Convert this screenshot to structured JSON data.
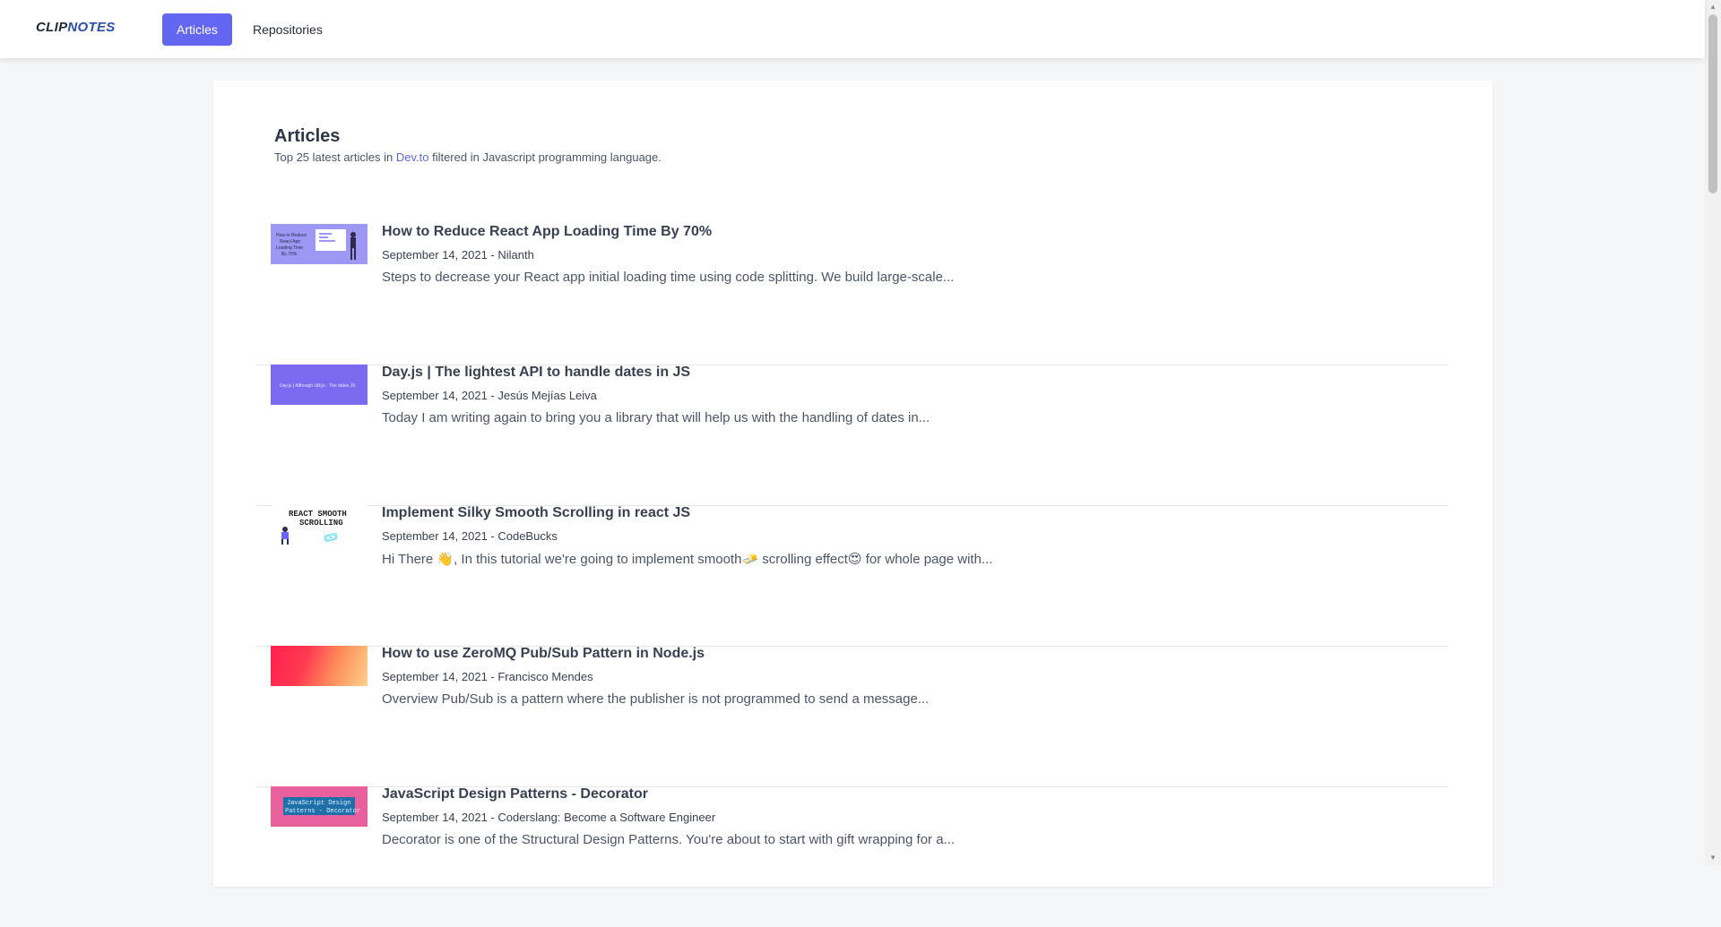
{
  "brand": {
    "part1": "CLIP",
    "part2": "NOTES"
  },
  "nav": {
    "articles": "Articles",
    "repositories": "Repositories"
  },
  "page": {
    "title": "Articles",
    "subtitle_pre": "Top 25 latest articles in ",
    "subtitle_link": "Dev.to",
    "subtitle_post": " filtered in Javascript programming language."
  },
  "articles": [
    {
      "title": "How to Reduce React App Loading Time By 70%",
      "meta": "September 14, 2021 - Nilanth",
      "desc": "Steps to decrease your React app initial loading time using code splitting. We build large-scale...",
      "thumb_text": "How to Reduce React App Loading Time By 70%"
    },
    {
      "title": "Day.js | The lightest API to handle dates in JS",
      "meta": "September 14, 2021 - Jesús Mejías Leiva",
      "desc": "Today I am writing again to bring you a library that will help us with the handling of dates in...",
      "thumb_text": "Day.js | Although Util.js"
    },
    {
      "title": "Implement Silky Smooth Scrolling in react JS",
      "meta": "September 14, 2021 - CodeBucks",
      "desc": "Hi There 👋, In this tutorial we're going to implement smooth🧈 scrolling effect😍 for whole page with...",
      "thumb_text": "REACT SMOOTH SCROLLING"
    },
    {
      "title": "How to use ZeroMQ Pub/Sub Pattern in Node.js",
      "meta": "September 14, 2021 - Francisco Mendes",
      "desc": "Overview Pub/Sub is a pattern where the publisher is not programmed to send a message...",
      "thumb_text": ""
    },
    {
      "title": "JavaScript Design Patterns - Decorator",
      "meta": "September 14, 2021 - Coderslang: Become a Software Engineer",
      "desc": "Decorator is one of the Structural Design Patterns. You're about to start with gift wrapping for a...",
      "thumb_text": "JavaScript Design Patterns - Decorator"
    }
  ]
}
